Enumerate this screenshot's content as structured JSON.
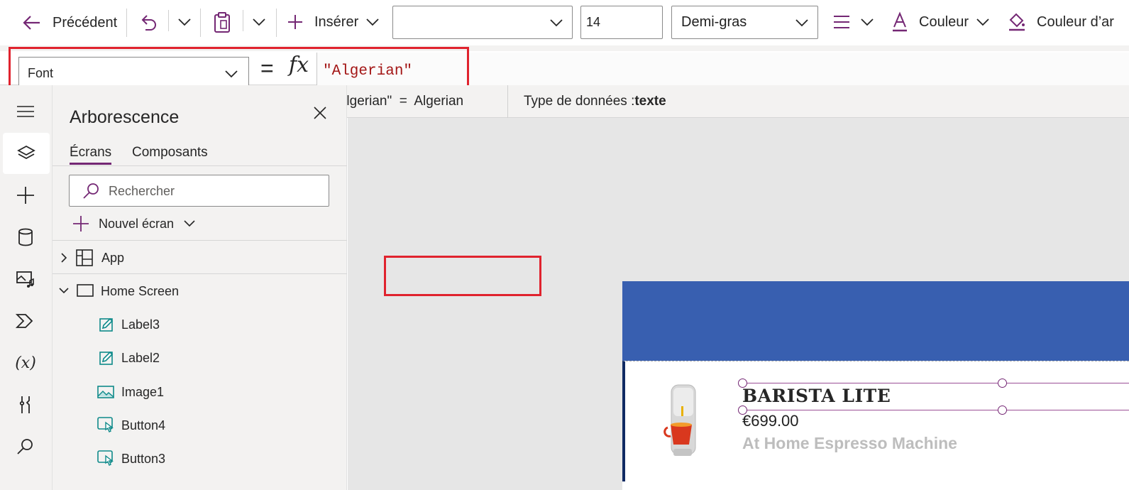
{
  "toolbar": {
    "back_label": "Précédent",
    "insert_label": "Insérer",
    "font_select_value": "",
    "font_size_value": "14",
    "font_weight_value": "Demi-gras",
    "color_label": "Couleur",
    "fill_label": "Couleur d’ar"
  },
  "formula_bar": {
    "property": "Font",
    "equals": "=",
    "fx": "fx",
    "formula": "\"Algerian\""
  },
  "hint": {
    "expression": "\"Algerian\"  =  Algerian",
    "type_prefix": "Type de données :",
    "type_value": "texte"
  },
  "tree_panel": {
    "title": "Arborescence",
    "tabs": [
      "Écrans",
      "Composants"
    ],
    "search_placeholder": "Rechercher",
    "new_screen_label": "Nouvel écran",
    "items": [
      {
        "label": "App",
        "icon": "app-grid-icon"
      },
      {
        "label": "Home Screen",
        "icon": "screen-icon"
      },
      {
        "label": "Label3",
        "icon": "label-edit-icon"
      },
      {
        "label": "Label2",
        "icon": "label-edit-icon"
      },
      {
        "label": "Image1",
        "icon": "image-icon"
      },
      {
        "label": "Button4",
        "icon": "button-icon"
      },
      {
        "label": "Button3",
        "icon": "button-icon"
      }
    ]
  },
  "canvas": {
    "product_title": "BARISTA LITE",
    "product_price": "€699.00",
    "product_desc": "At Home Espresso Machine"
  },
  "colors": {
    "accent": "#742774",
    "header_blue": "#385fb0",
    "highlight_red": "#e0232e"
  }
}
